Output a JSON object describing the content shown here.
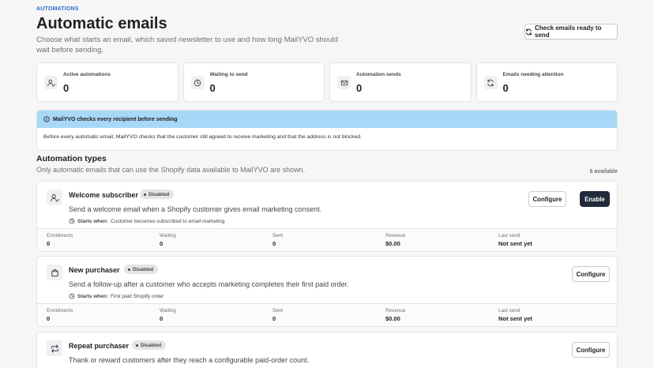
{
  "header": {
    "eyebrow": "AUTOMATIONS",
    "title": "Automatic emails",
    "subtitle": "Choose what starts an email, which saved newsletter to use and how long MailYVO should wait before sending.",
    "check_button": "Check emails ready to send",
    "check_icon": "refresh-icon"
  },
  "stats": [
    {
      "label": "Active automations",
      "value": "0",
      "icon": "user-check-icon"
    },
    {
      "label": "Waiting to send",
      "value": "0",
      "icon": "clock-icon"
    },
    {
      "label": "Automation sends",
      "value": "0",
      "icon": "mail-icon"
    },
    {
      "label": "Emails needing attention",
      "value": "0",
      "icon": "refresh-icon"
    }
  ],
  "banner": {
    "title": "MailYVO checks every recipient before sending",
    "body": "Before every automatic email, MailYVO checks that the customer still agreed to receive marketing and that the address is not blocked.",
    "color": "#a7d8f7"
  },
  "section": {
    "title": "Automation types",
    "subtitle": "Only automatic emails that can use the Shopify data available to MailYVO are shown.",
    "count": "6 available"
  },
  "metric_labels": {
    "enrollments": "Enrollments",
    "waiting": "Waiting",
    "sent": "Sent",
    "revenue": "Revenue",
    "last_send": "Last send"
  },
  "starts_when_label": "Starts when:",
  "automations": [
    {
      "name": "Welcome subscriber",
      "status": "Disabled",
      "icon": "user-check-icon",
      "description": "Send a welcome email when a Shopify customer gives email marketing consent.",
      "starts_when": "Customer becomes subscribed to email marketing",
      "configure": "Configure",
      "enable": "Enable",
      "metrics": {
        "enrollments": "0",
        "waiting": "0",
        "sent": "0",
        "revenue": "$0.00",
        "last_send": "Not sent yet"
      }
    },
    {
      "name": "New purchaser",
      "status": "Disabled",
      "icon": "shopping-bag-icon",
      "description": "Send a follow-up after a customer who accepts marketing completes their first paid order.",
      "starts_when": "First paid Shopify order",
      "configure": "Configure",
      "metrics": {
        "enrollments": "0",
        "waiting": "0",
        "sent": "0",
        "revenue": "$0.00",
        "last_send": "Not sent yet"
      }
    },
    {
      "name": "Repeat purchaser",
      "status": "Disabled",
      "icon": "repeat-icon",
      "description": "Thank or reward customers after they reach a configurable paid-order count.",
      "configure": "Configure"
    }
  ],
  "colors": {
    "primary_button": "#202a3a",
    "accent": "#2c6ecb",
    "background": "#f6f6f7"
  }
}
